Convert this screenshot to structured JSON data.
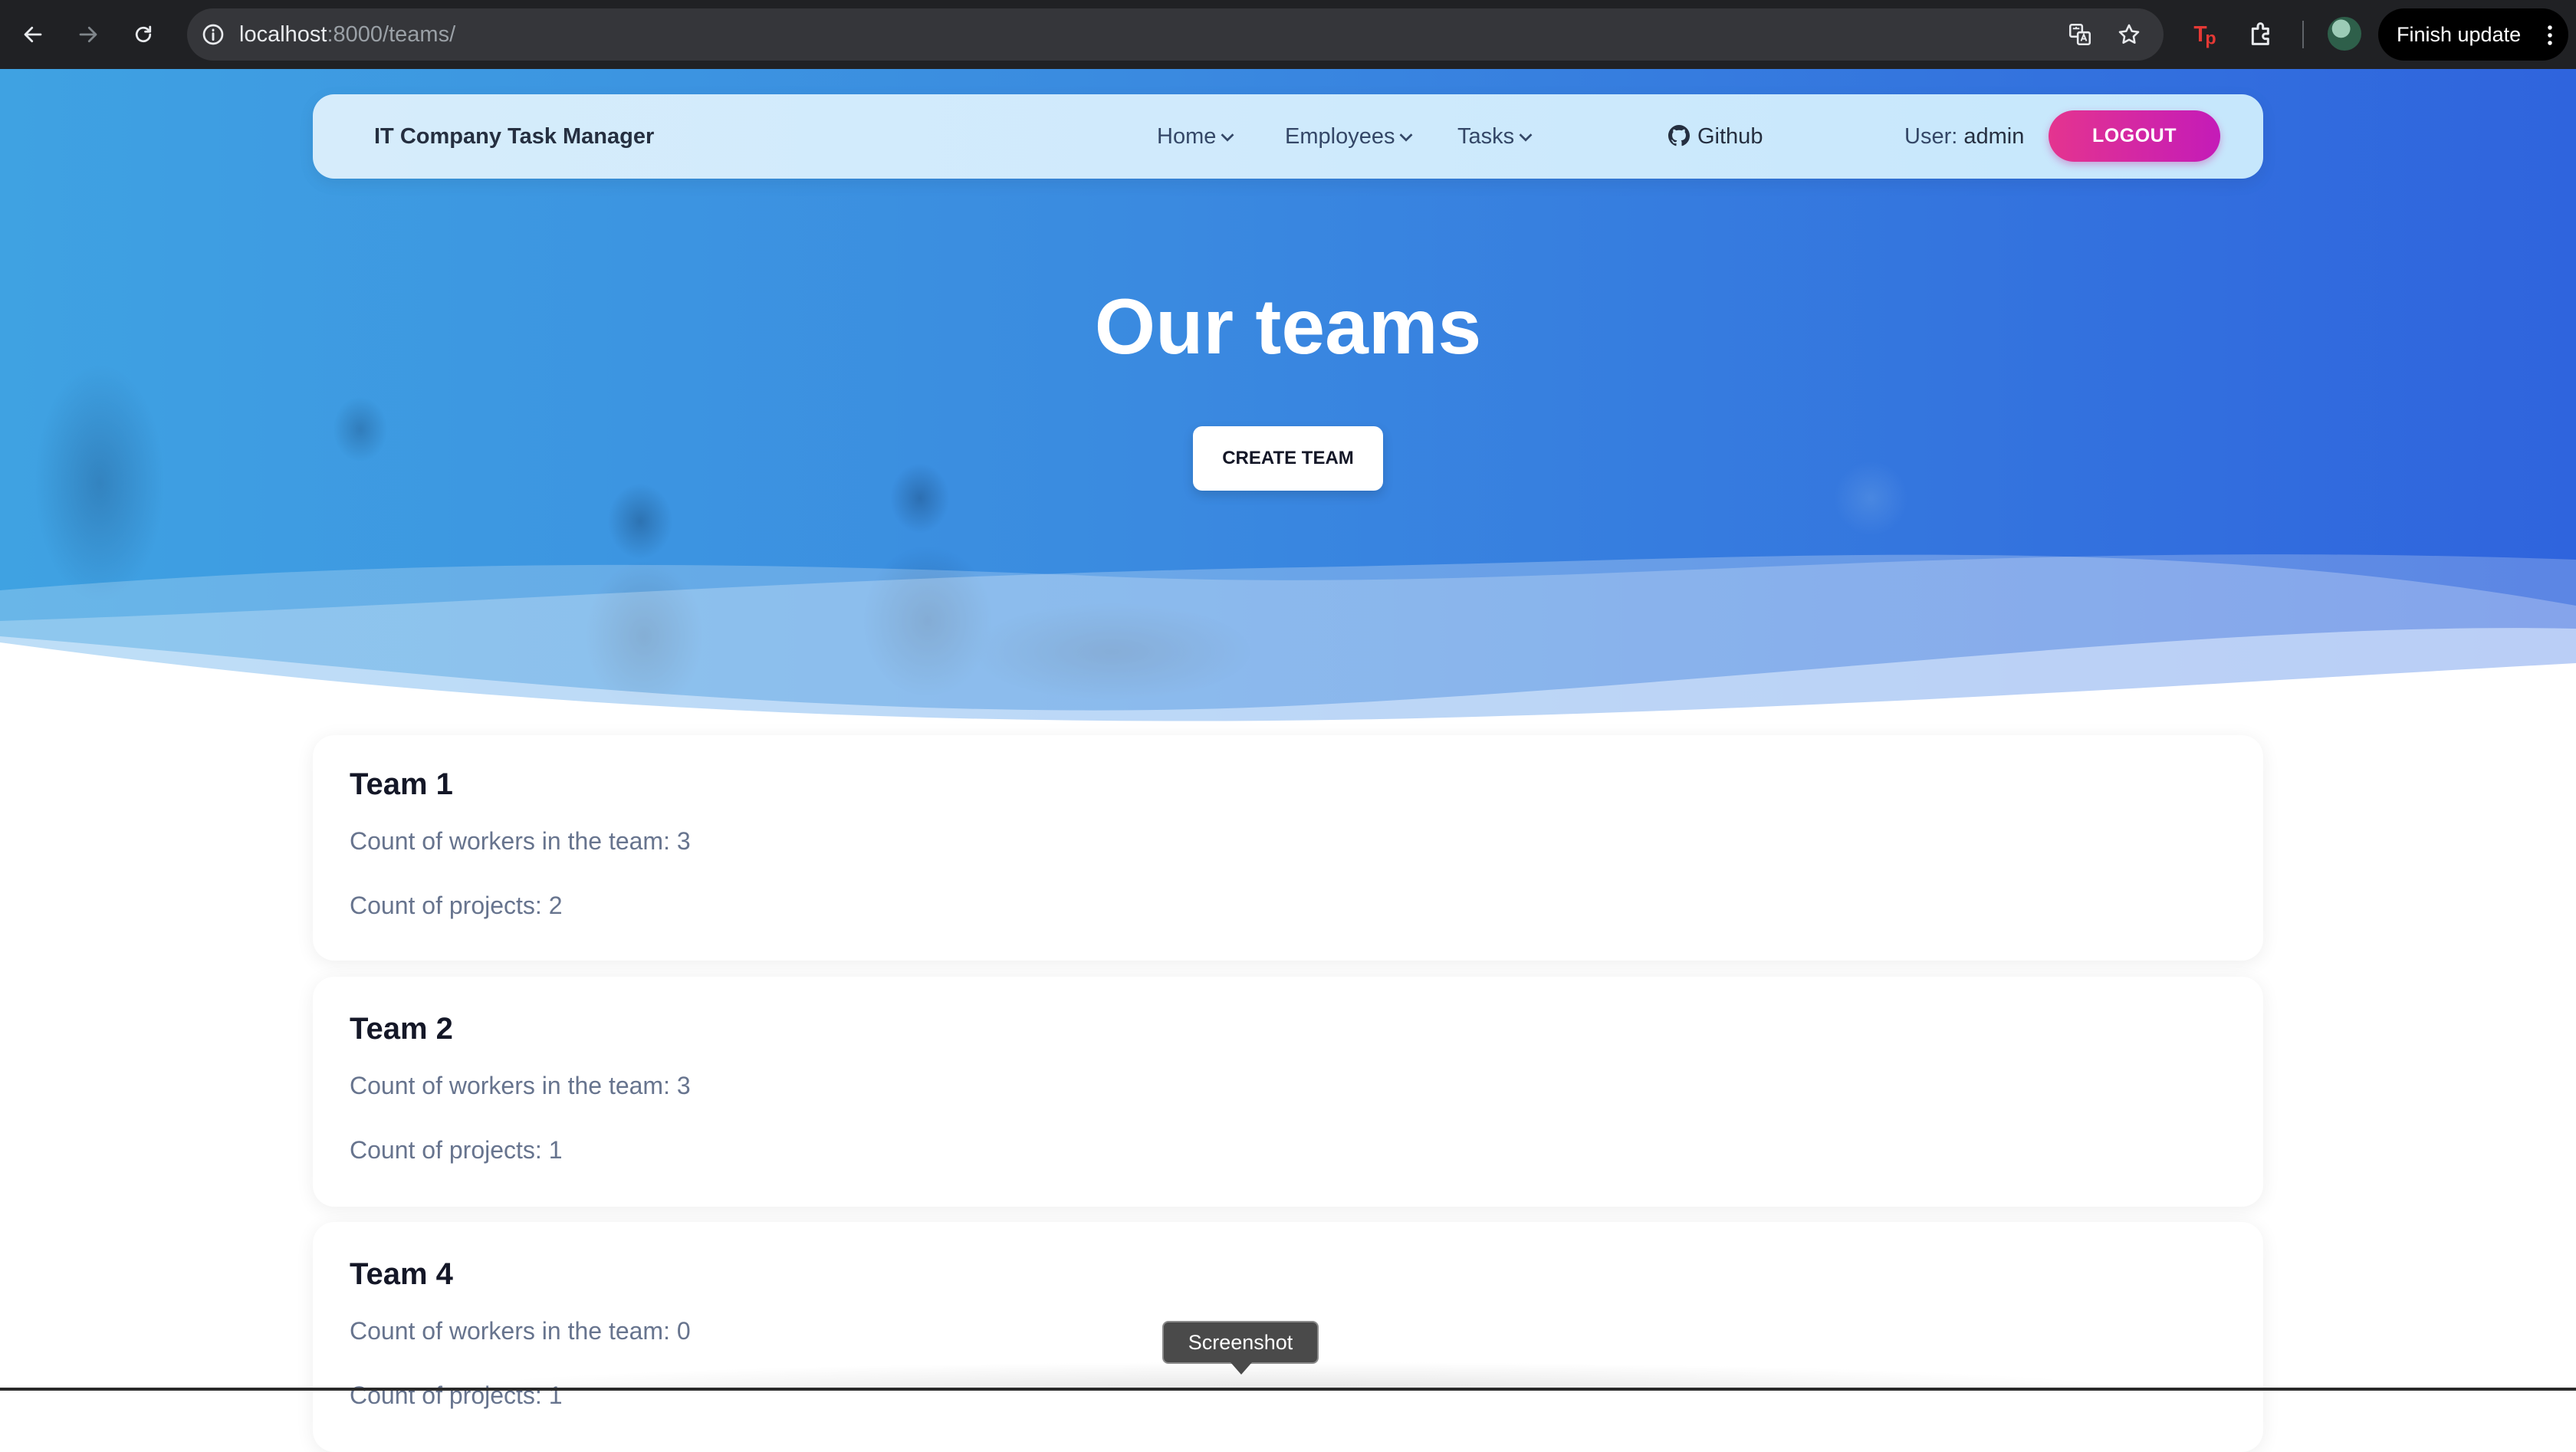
{
  "browser": {
    "url_host": "localhost",
    "url_path": ":8000/teams/",
    "update_label": "Finish update"
  },
  "navbar": {
    "brand": "IT Company Task Manager",
    "menu": [
      "Home",
      "Employees",
      "Tasks"
    ],
    "github_label": "Github",
    "user_prefix": "User: ",
    "user_name": "admin",
    "logout_label": "LOGOUT"
  },
  "hero": {
    "title": "Our teams",
    "create_label": "CREATE TEAM"
  },
  "teams": [
    {
      "name": "Team 1",
      "workers": "Count of workers in the team: 3",
      "projects": "Count of projects: 2"
    },
    {
      "name": "Team 2",
      "workers": "Count of workers in the team: 3",
      "projects": "Count of projects: 1"
    },
    {
      "name": "Team 4",
      "workers": "Count of workers in the team: 0",
      "projects": "Count of projects: 1"
    }
  ],
  "tooltip": "Screenshot",
  "colors": {
    "hero_left": "#3fa2e2",
    "hero_right": "#2f64dd",
    "logout_gradient_start": "#e4348f",
    "logout_gradient_end": "#c41bb8",
    "text_muted": "#67748e"
  }
}
